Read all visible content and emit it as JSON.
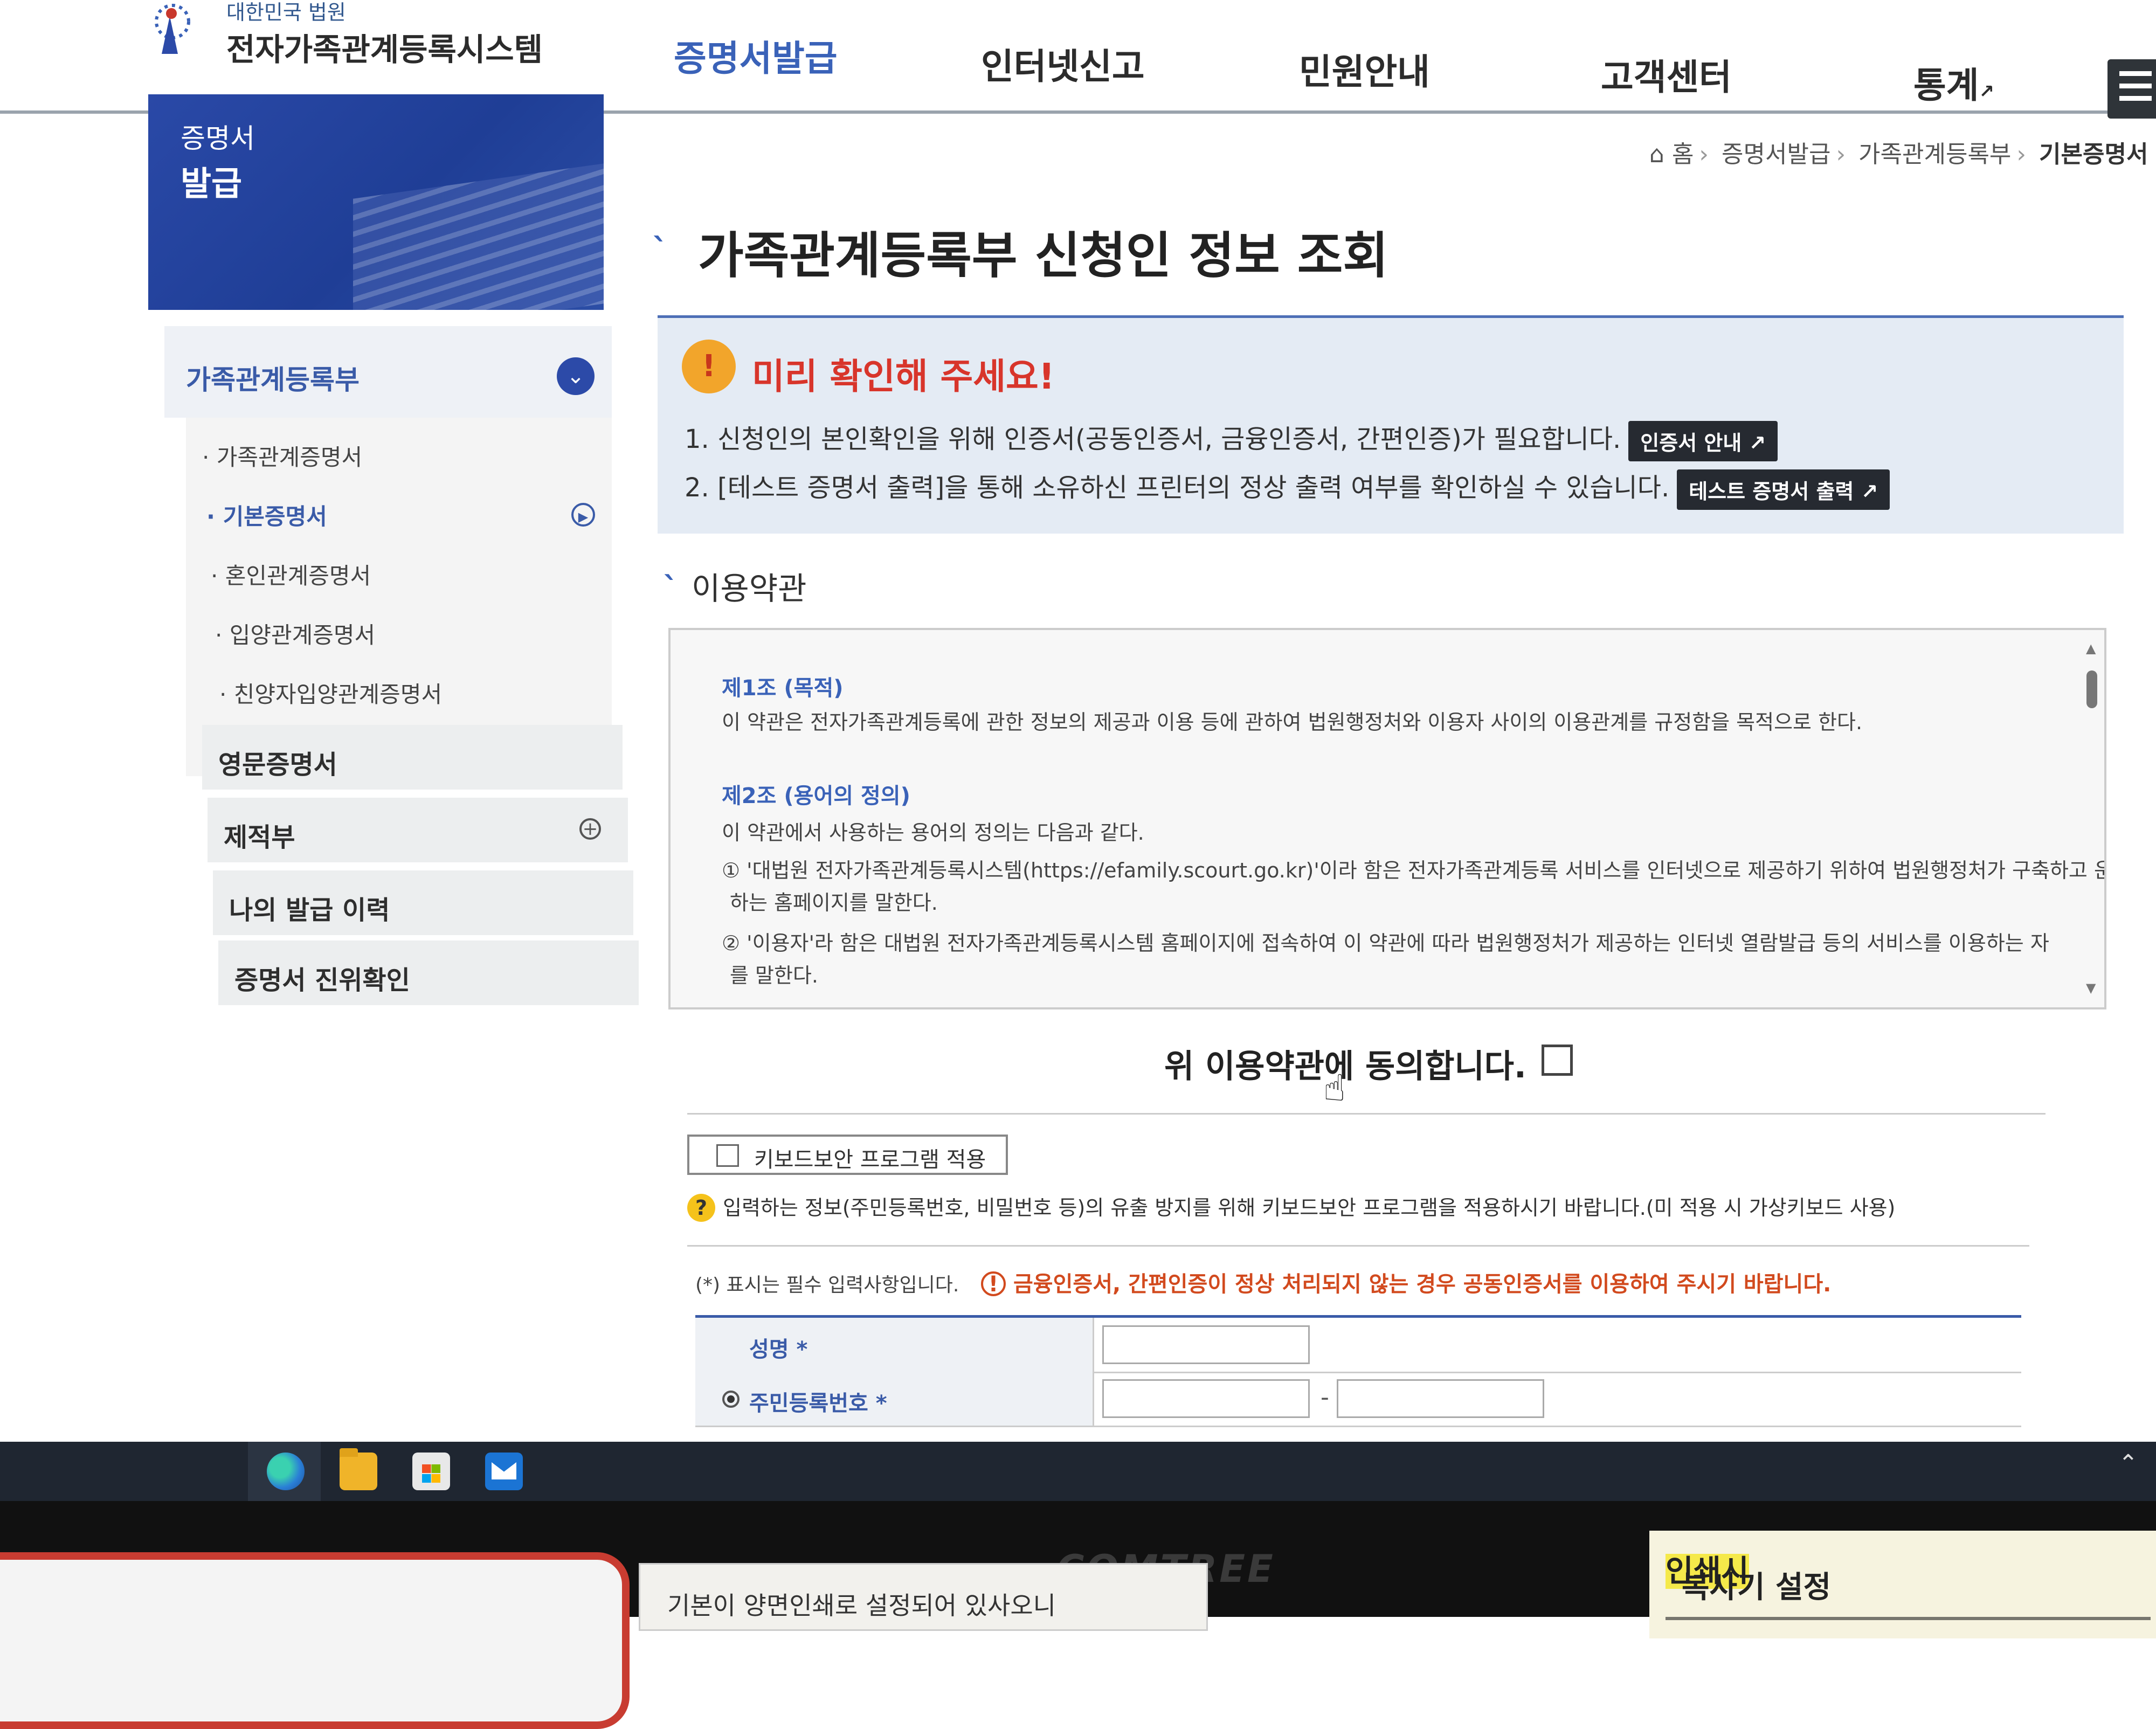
{
  "header": {
    "logo_sub": "대한민국 법원",
    "logo_main": "전자가족관계등록시스템",
    "nav": [
      "증명서발급",
      "인터넷신고",
      "민원안내",
      "고객센터",
      "통계"
    ]
  },
  "lnb": {
    "banner_line1": "증명서",
    "banner_line2": "발급",
    "section_title": "가족관계등록부",
    "sub_items": [
      "가족관계증명서",
      "기본증명서",
      "혼인관계증명서",
      "입양관계증명서",
      "친양자입양관계증명서"
    ],
    "main_items": [
      "영문증명서",
      "제적부",
      "나의 발급 이력",
      "증명서 진위확인"
    ]
  },
  "breadcrumb": [
    "홈",
    "증명서발급",
    "가족관계등록부",
    "기본증명서"
  ],
  "page_title": "가족관계등록부 신청인 정보 조회",
  "notice": {
    "heading": "미리 확인해 주세요!",
    "line1": "1. 신청인의 본인확인을 위해 인증서(공동인증서, 금융인증서, 간편인증)가 필요합니다.",
    "line1_button": "인증서 안내",
    "line2": "2. [테스트 증명서 출력]을 통해 소유하신 프린터의 정상 출력 여부를 확인하실 수 있습니다.",
    "line2_button": "테스트 증명서 출력"
  },
  "terms": {
    "heading": "이용약관",
    "art1_title": "제1조 (목적)",
    "art1_text": "이 약관은 전자가족관계등록에 관한 정보의 제공과 이용 등에 관하여 법원행정처와 이용자 사이의 이용관계를 규정함을 목적으로 한다.",
    "art2_title": "제2조 (용어의 정의)",
    "art2_text": "이 약관에서 사용하는 용어의 정의는 다음과 같다.",
    "art2_item1a": "① '대법원 전자가족관계등록시스템(https://efamily.scourt.go.kr)'이라 함은 전자가족관계등록 서비스를 인터넷으로 제공하기 위하여 법원행정처가 구축하고 운영",
    "art2_item1b": "하는 홈페이지를 말한다.",
    "art2_item2a": "② '이용자'라 함은 대법원 전자가족관계등록시스템 홈페이지에 접속하여 이 약관에 따라 법원행정처가 제공하는 인터넷 열람발급 등의 서비스를 이용하는 자",
    "art2_item2b": "를 말한다.",
    "agree_label": "위 이용약관에 동의합니다."
  },
  "keyboard": {
    "button_label": "키보드보안 프로그램 적용",
    "note": "입력하는 정보(주민등록번호, 비밀번호 등)의 유출 방지를 위해 키보드보안 프로그램을 적용하시기 바랍니다.(미 적용 시 가상키보드 사용)"
  },
  "required_note": "(*) 표시는 필수 입력사항입니다.",
  "warning": "금융인증서, 간편인증이 정상 처리되지 않는 경우 공동인증서를 이용하여 주시기 바랍니다.",
  "form": {
    "name_label": "성명 *",
    "rrn_label": "주민등록번호 *"
  },
  "notes": {
    "left": "기본이 양면인쇄로 설정되어 있사오니",
    "right_highlight": "인쇄시",
    "right_rest": " 복사기 설정"
  },
  "bezel_logo": "COMTREE"
}
